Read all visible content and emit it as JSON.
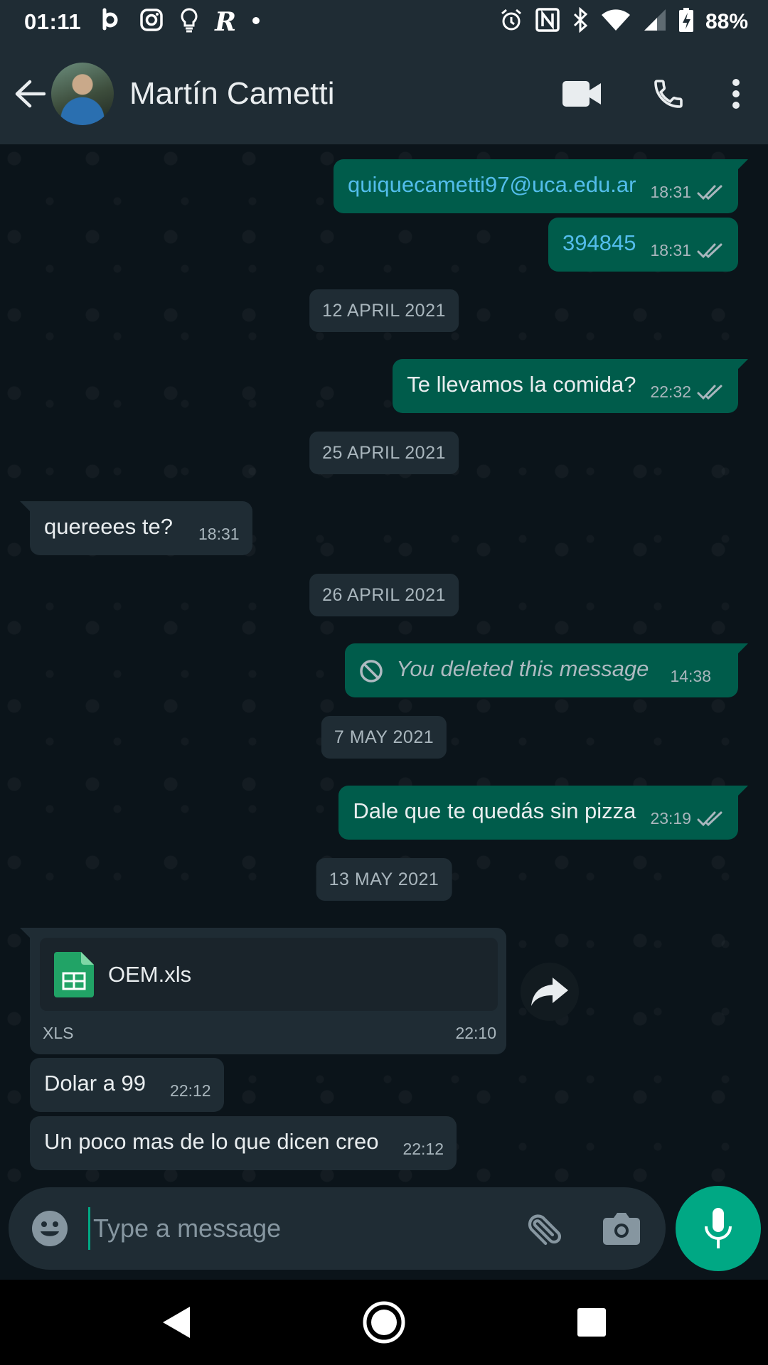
{
  "status_bar": {
    "time": "01:11",
    "battery_percent": "88%",
    "left_icons": [
      "bereal-icon",
      "instagram-icon",
      "lightbulb-icon",
      "r-app-icon",
      "dot-icon"
    ],
    "right_icons": [
      "alarm-icon",
      "nfc-icon",
      "bluetooth-icon",
      "wifi-icon",
      "signal-icon",
      "battery-charging-icon"
    ]
  },
  "header": {
    "contact_name": "Martín Cametti",
    "actions": [
      "video-call-icon",
      "voice-call-icon",
      "more-vert-icon"
    ]
  },
  "messages": [
    {
      "direction": "out",
      "text": "quiquecametti97@uca.edu.ar",
      "time": "18:31",
      "type": "link",
      "status": "read"
    },
    {
      "direction": "out",
      "text": "394845",
      "time": "18:31",
      "type": "link",
      "status": "read"
    },
    {
      "type": "date",
      "text": "12 APRIL 2021"
    },
    {
      "direction": "out",
      "text": "Te llevamos la comida?",
      "time": "22:32",
      "status": "read"
    },
    {
      "type": "date",
      "text": "25 APRIL 2021"
    },
    {
      "direction": "in",
      "text": "quereees te?",
      "time": "18:31"
    },
    {
      "type": "date",
      "text": "26 APRIL 2021"
    },
    {
      "direction": "out",
      "text": "You deleted this message",
      "time": "14:38",
      "type": "deleted"
    },
    {
      "type": "date",
      "text": "7 MAY 2021"
    },
    {
      "direction": "out",
      "text": "Dale que te quedás sin pizza",
      "time": "23:19",
      "status": "read"
    },
    {
      "type": "date",
      "text": "13 MAY 2021"
    },
    {
      "direction": "in",
      "type": "document",
      "file_name": "OEM.xls",
      "file_type": "XLS",
      "time": "22:10"
    },
    {
      "direction": "in",
      "text": "Dolar a 99",
      "time": "22:12"
    },
    {
      "direction": "in",
      "text": "Un poco mas de lo que dicen creo",
      "time": "22:12"
    }
  ],
  "input": {
    "placeholder": "Type a message"
  },
  "colors": {
    "background": "#0b141a",
    "bar": "#1f2c34",
    "outgoing_bubble": "#005c4b",
    "incoming_bubble": "#1f2c34",
    "accent": "#00a884",
    "link": "#53bdeb",
    "read_ticks": "#a9b6bd",
    "sheet_icon": "#21a366"
  }
}
